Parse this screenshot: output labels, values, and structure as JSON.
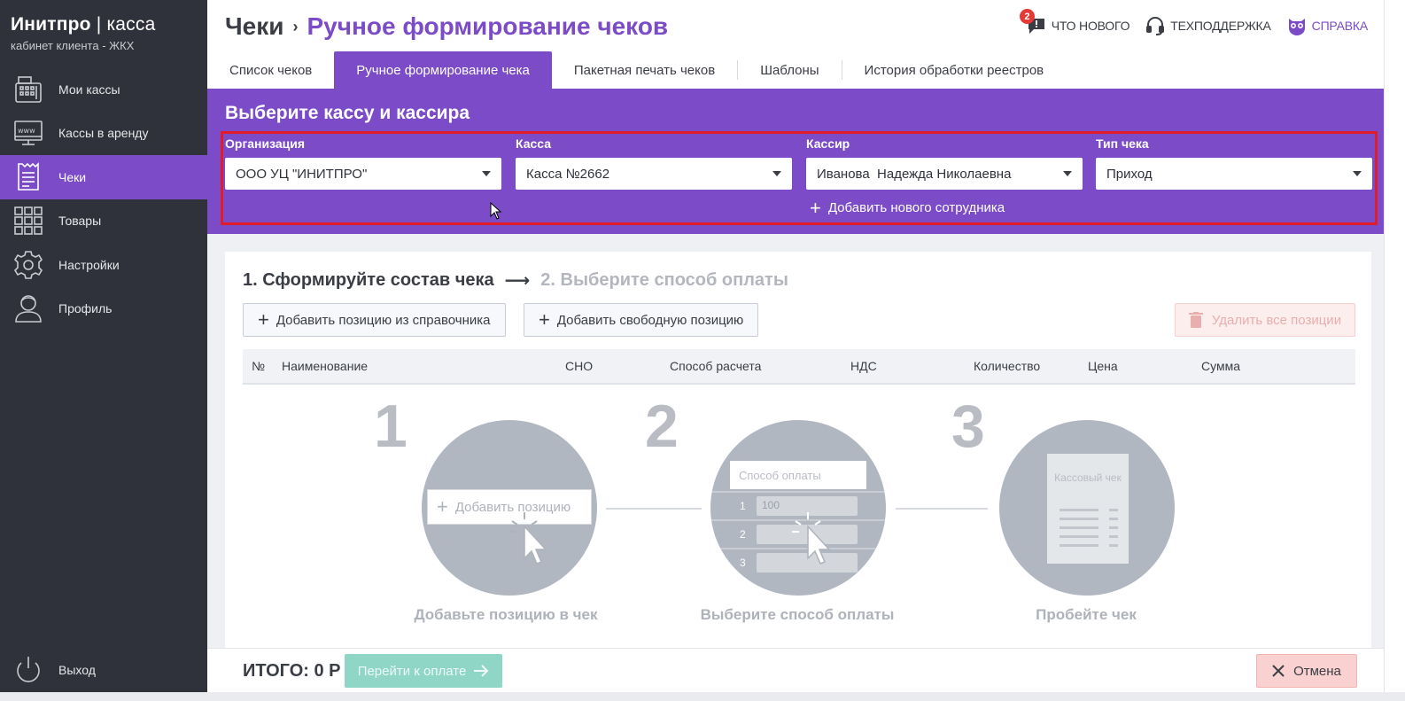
{
  "sidebar": {
    "brand_bold": "Инитпро",
    "brand_sep": " | ",
    "brand_light": "касса",
    "subtitle": "кабинет клиента - ЖКХ",
    "items": [
      {
        "label": "Мои кассы",
        "icon": "cash-register-icon"
      },
      {
        "label": "Кассы в аренду",
        "icon": "www-monitor-icon"
      },
      {
        "label": "Чеки",
        "icon": "receipt-icon",
        "active": true
      },
      {
        "label": "Товары",
        "icon": "grid-icon"
      },
      {
        "label": "Настройки",
        "icon": "gear-icon"
      },
      {
        "label": "Профиль",
        "icon": "user-icon"
      }
    ],
    "logout": "Выход"
  },
  "header": {
    "crumb_root": "Чеки",
    "crumb_current": "Ручное формирование чеков",
    "whats_new": "ЧТО НОВОГО",
    "whats_new_badge": "2",
    "support": "ТЕХПОДДЕРЖКА",
    "help": "СПРАВКА"
  },
  "tabs": [
    {
      "label": "Список чеков"
    },
    {
      "label": "Ручное формирование чека",
      "active": true
    },
    {
      "label": "Пакетная печать чеков"
    },
    {
      "label": "Шаблоны"
    },
    {
      "label": "История обработки реестров"
    }
  ],
  "selection": {
    "title": "Выберите кассу и кассира",
    "org_label": "Организация",
    "org_value": "ООО УЦ \"ИНИТПРО\"",
    "kassa_label": "Касса",
    "kassa_value": "Касса №2662",
    "cashier_label": "Кассир",
    "cashier_value": "Иванова  Надежда Николаевна",
    "type_label": "Тип чека",
    "type_value": "Приход",
    "add_employee": "Добавить нового сотрудника"
  },
  "card": {
    "step1": "1. Сформируйте состав чека",
    "step2": "2. Выберите способ оплаты",
    "add_from_catalog": "Добавить позицию из справочника",
    "add_free": "Добавить свободную позицию",
    "delete_all": "Удалить все позиции",
    "columns": [
      "№",
      "Наименование",
      "СНО",
      "Способ расчета",
      "НДС",
      "Количество",
      "Цена",
      "Сумма"
    ],
    "illus": {
      "n1": "1",
      "n2": "2",
      "n3": "3",
      "add_position": "Добавить позицию",
      "pay_method": "Способ оплаты",
      "row1": "1",
      "row2": "2",
      "row3": "3",
      "row1_val": "100",
      "receipt_title": "Кассовый чек",
      "cap1": "Добавьте позицию в чек",
      "cap2": "Выберите способ оплаты",
      "cap3": "Пробейте чек"
    }
  },
  "footer": {
    "total": "ИТОГО: 0 Р",
    "pay": "Перейти к оплате",
    "cancel": "Отмена"
  },
  "colors": {
    "accent": "#7b4bc8",
    "sidebar_bg": "#2f323a",
    "highlight_frame": "#e11b2a",
    "pay_disabled": "#8fd6c6",
    "cancel_bg": "#f9d1d0"
  }
}
